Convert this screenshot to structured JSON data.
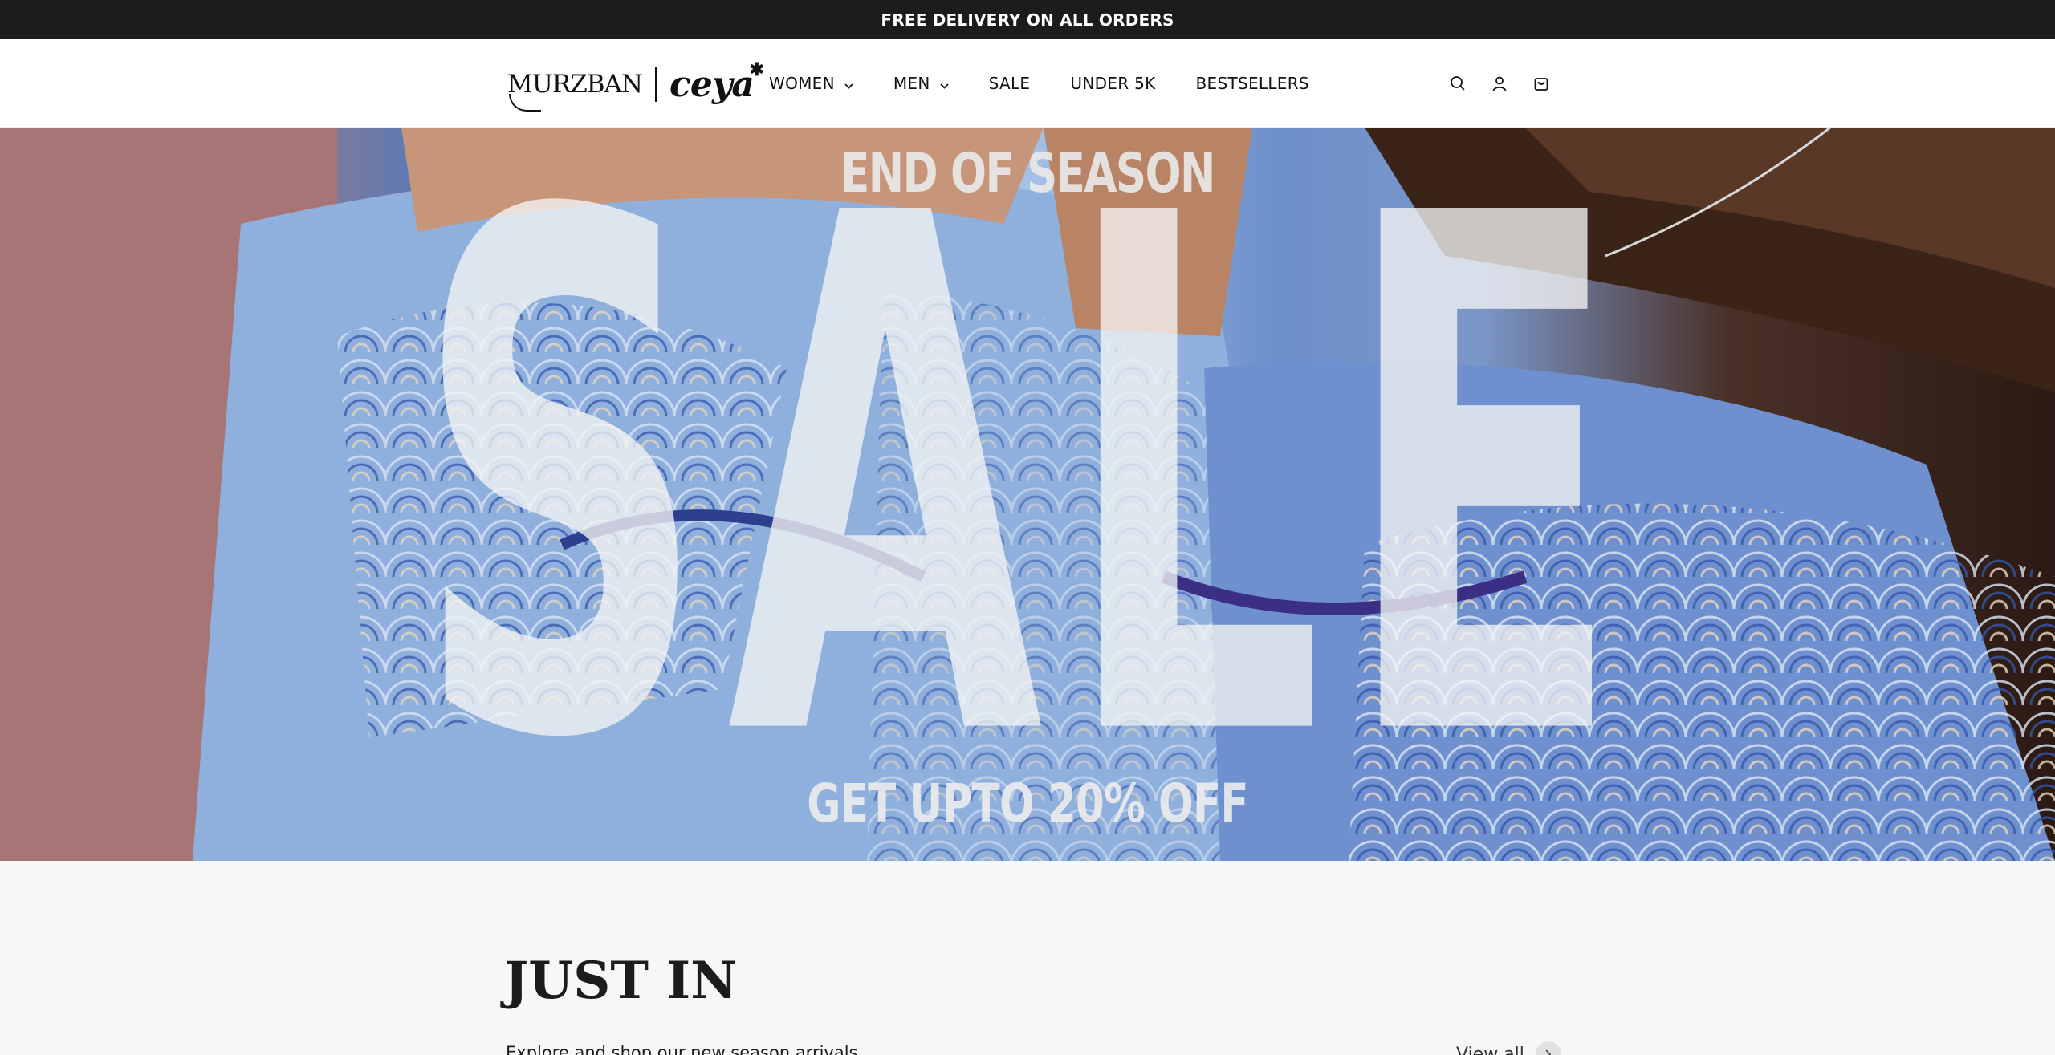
{
  "announcement": {
    "text": "FREE DELIVERY ON ALL ORDERS"
  },
  "header": {
    "logo": {
      "brand_1": "MURZBAN",
      "brand_2": "ceya",
      "brand_2_mark": "✱"
    },
    "nav": [
      {
        "label": "WOMEN",
        "has_dropdown": true
      },
      {
        "label": "MEN",
        "has_dropdown": true
      },
      {
        "label": "SALE",
        "has_dropdown": false
      },
      {
        "label": "UNDER 5K",
        "has_dropdown": false
      },
      {
        "label": "BESTSELLERS",
        "has_dropdown": false
      }
    ],
    "icons": [
      "search-icon",
      "account-icon",
      "cart-icon"
    ]
  },
  "hero": {
    "line_top": "END OF SEASON",
    "headline": "SALE",
    "line_bottom": "GET UPTO 20% OFF"
  },
  "section": {
    "title": "JUST IN",
    "subtitle": "Explore and shop our new season arrivals",
    "view_all": "View all"
  },
  "colors": {
    "announcement_bg": "#1c1c1c",
    "page_bg": "#f7f7f7",
    "text": "#1a1a1a"
  }
}
